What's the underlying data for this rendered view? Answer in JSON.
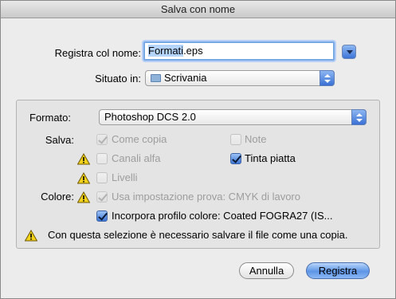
{
  "window": {
    "title": "Salva con nome"
  },
  "save": {
    "name_label": "Registra col nome:",
    "filename_base": "Formati",
    "filename_ext": ".eps",
    "location_label": "Situato in:",
    "location_value": "Scrivania"
  },
  "options": {
    "format_label": "Formato:",
    "format_value": "Photoshop DCS 2.0",
    "save_label": "Salva:",
    "color_label": "Colore:",
    "checkboxes": {
      "as_copy": {
        "label": "Come copia",
        "checked": true,
        "enabled": false
      },
      "notes": {
        "label": "Note",
        "checked": false,
        "enabled": false
      },
      "alpha": {
        "label": "Canali alfa",
        "checked": false,
        "enabled": false
      },
      "spot": {
        "label": "Tinta piatta",
        "checked": true,
        "enabled": true
      },
      "layers": {
        "label": "Livelli",
        "checked": false,
        "enabled": false
      },
      "proof": {
        "label": "Usa impostazione prova:  CMYK di lavoro",
        "checked": true,
        "enabled": false
      },
      "profile": {
        "label": "Incorpora profilo colore:  Coated FOGRA27 (IS...",
        "checked": true,
        "enabled": true
      }
    },
    "warning_text": "Con questa selezione è necessario salvare il file come una copia."
  },
  "buttons": {
    "cancel": "Annulla",
    "save": "Registra"
  },
  "colors": {
    "accent": "#3c73d4",
    "warning": "#f2d21b"
  }
}
